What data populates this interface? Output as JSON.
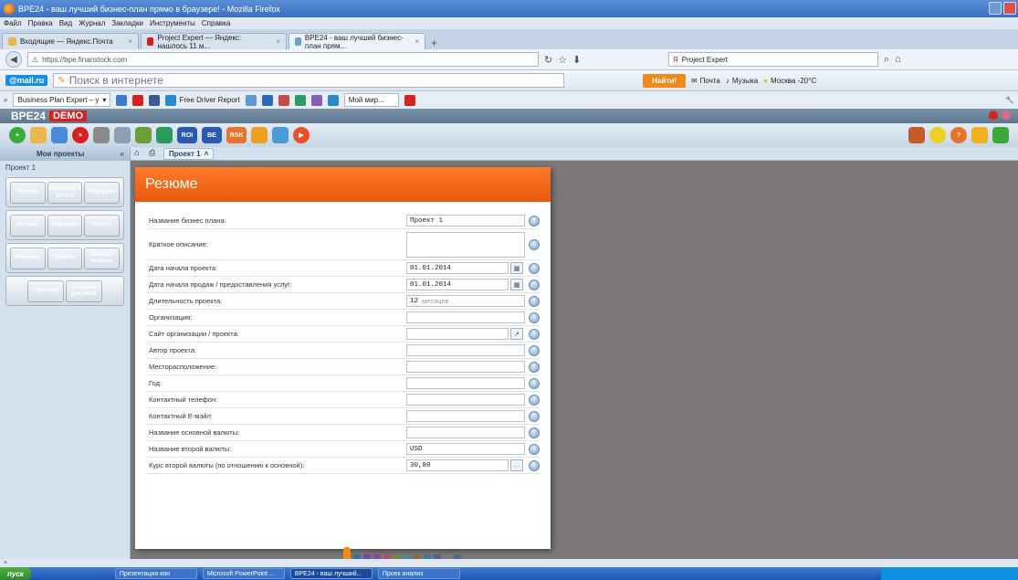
{
  "window": {
    "title": "BPE24 - ваш лучший бизнес-план прямо в браузере! - Mozilla Firefox"
  },
  "menu": [
    "Файл",
    "Правка",
    "Вид",
    "Журнал",
    "Закладки",
    "Инструменты",
    "Справка"
  ],
  "tabs": [
    {
      "label": "Входящие — Яндекс.Почта",
      "color": "#e8b84a"
    },
    {
      "label": "Project Expert — Яндекс: нашлось 11 м...",
      "color": "#d82020"
    },
    {
      "label": "BPE24 - ваш лучший бизнес-план прям...",
      "color": "#6aa0d8"
    }
  ],
  "nav": {
    "url": "https://bpe.finanstock.com",
    "search": "Project Expert"
  },
  "mailbar": {
    "logo": "@mail.ru",
    "search_placeholder": "Поиск в интернете",
    "find": "Найти!",
    "mail": "Почта",
    "music": "Музыка",
    "weather": "Москва -20°C"
  },
  "toolrow": {
    "combo": "Business Plan Expert – y",
    "report": "Free Driver Report",
    "combo2": "Мой мир..."
  },
  "app": {
    "logo": "BPE24",
    "badge": "DEMO"
  },
  "left_panel": {
    "header": "Мои проекты",
    "tree_root": "Проект 1",
    "rows": [
      [
        {
          "label": "Резюме",
          "color": "#e8b84a"
        },
        {
          "label": "Продукты и услуги",
          "color": "#4a8ad8"
        },
        {
          "label": "Издержки",
          "color": "#c04ac8"
        }
      ],
      [
        {
          "label": "Активы",
          "color": "#2a9ab0"
        },
        {
          "label": "Инфляция",
          "color": "#6ab83a"
        },
        {
          "label": "Налоги",
          "color": "#e85a2a"
        }
      ],
      [
        {
          "label": "Финансы",
          "color": "#2aa05a"
        },
        {
          "label": "Расчёты",
          "color": "#c87a2a"
        },
        {
          "label": "Бизнес-модель",
          "color": "#a8a8b0"
        }
      ],
      [
        {
          "label": "Структура",
          "color": "#8a6ad8"
        },
        {
          "label": "Готовый документ",
          "color": "#e8742a"
        }
      ]
    ]
  },
  "workspace": {
    "tab_label": "Проект 1"
  },
  "form": {
    "title": "Резюме",
    "fields": [
      {
        "label": "Название бизнес плана:",
        "value": "Проект 1"
      },
      {
        "label": "Краткое описание:",
        "value": ""
      },
      {
        "label": "Дата начала проекта:",
        "value": "01.01.2014"
      },
      {
        "label": "Дата начала продаж / предоставления услуг:",
        "value": "01.01.2014"
      },
      {
        "label": "Длительность проекта:",
        "value": "12",
        "unit": "месяцев"
      },
      {
        "label": "Организация:",
        "value": ""
      },
      {
        "label": "Сайт организации / проекта:",
        "value": ""
      },
      {
        "label": "Автор проекта:",
        "value": ""
      },
      {
        "label": "Месторасположение:",
        "value": ""
      },
      {
        "label": "Год:",
        "value": ""
      },
      {
        "label": "Контактный телефон:",
        "value": ""
      },
      {
        "label": "Контактный E-мэйл:",
        "value": ""
      },
      {
        "label": "Название основной валюты:",
        "value": ""
      },
      {
        "label": "Название второй валюты:",
        "value": "USD"
      },
      {
        "label": "Курс второй валюты (по отношению к основной):",
        "value": "30,80"
      }
    ],
    "pager_colors": [
      "#3a6ab0",
      "#6a4ab0",
      "#8a4a9a",
      "#b04a6a",
      "#6a8a3a",
      "#4a8a8a",
      "#8a6a3a",
      "#3a7a9a",
      "#5a5aa0",
      "#7a7a7a",
      "#4a6a9a"
    ]
  },
  "statusbar": "×",
  "taskbar": {
    "start": "пуск",
    "items": [
      "Презентация кон",
      "Microsoft PowerPoint ...",
      "BPE24 - ваш лучший...",
      "Проек анализ"
    ]
  }
}
